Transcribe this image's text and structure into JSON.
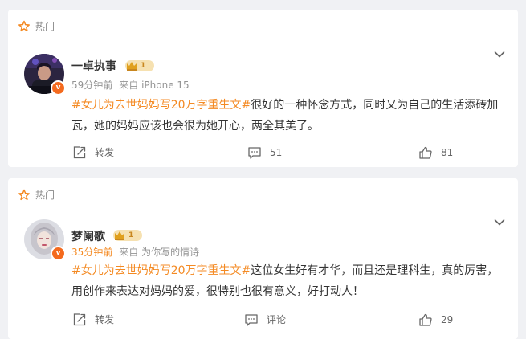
{
  "colors": {
    "accent": "#f48a23",
    "tag": "#f48a23",
    "background": "#f0f1f4",
    "verified_badge": "#f46a1e"
  },
  "posts": [
    {
      "section_label": "热门",
      "author": "一卓执事",
      "level": "1",
      "time": "59分钟前",
      "source": "来自 iPhone 15",
      "hashtag": "#女儿为去世妈妈写20万字重生文#",
      "body": "很好的一种怀念方式，同时又为自己的生活添砖加瓦，她的妈妈应该也会很为她开心，两全其美了。",
      "repost_label": "转发",
      "comment_count": "51",
      "like_count": "81"
    },
    {
      "section_label": "热门",
      "author": "梦阑歌",
      "level": "1",
      "time": "35分钟前",
      "source": "来自 为你写的情诗",
      "hashtag": "#女儿为去世妈妈写20万字重生文#",
      "body": "这位女生好有才华，而且还是理科生，真的厉害，用创作来表达对妈妈的爱，很特别也很有意义，好打动人！",
      "repost_label": "转发",
      "comment_label": "评论",
      "like_count": "29"
    }
  ]
}
